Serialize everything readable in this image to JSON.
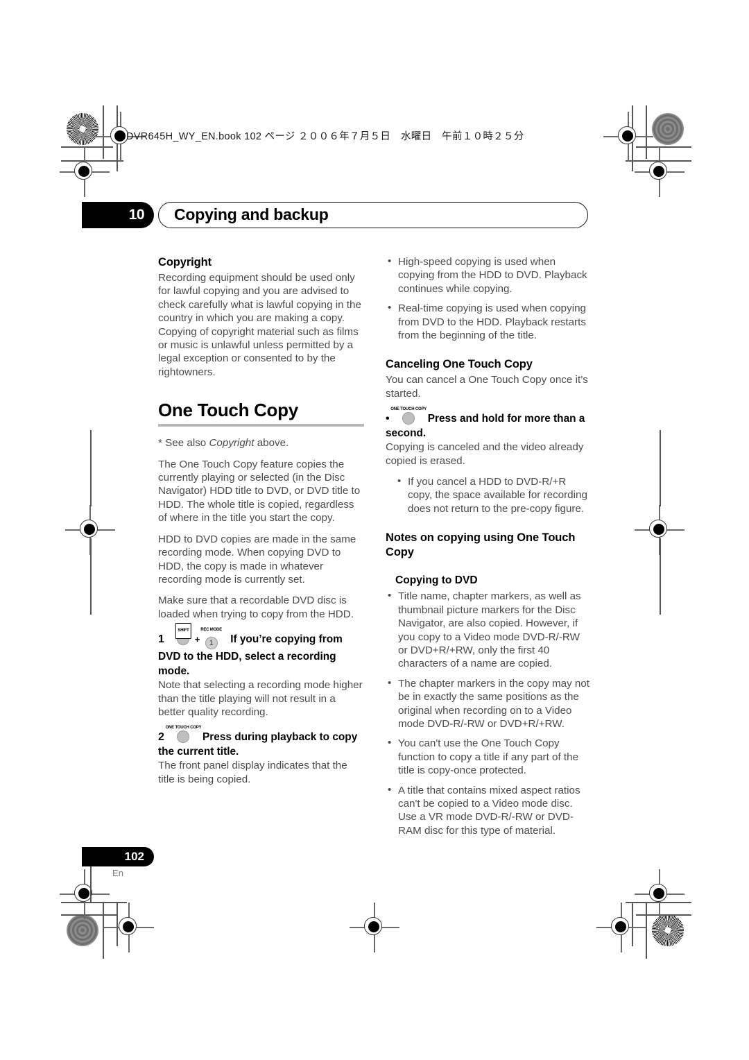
{
  "book_header": "DVR645H_WY_EN.book 102 ページ ２００６年７月５日　水曜日　午前１０時２５分",
  "chapter": {
    "number": "10",
    "title": "Copying and backup"
  },
  "footer": {
    "page_number": "102",
    "language": "En"
  },
  "left_column": {
    "copyright_heading": "Copyright",
    "copyright_body": "Recording equipment should be used only for lawful copying and you are advised to check carefully what is lawful copying in the country in which you are making a copy. Copying of copyright material such as films or music is unlawful unless permitted by a legal exception or consented to by the rightowners.",
    "one_touch_copy_heading": "One Touch Copy",
    "see_also_prefix": "* See also ",
    "see_also_italic": "Copyright",
    "see_also_suffix": " above.",
    "para_feature": "The One Touch Copy feature copies the currently playing or selected (in the Disc Navigator) HDD title to DVD, or DVD title to HDD. The whole title is copied, regardless of where in the title you start the copy.",
    "para_modes": "HDD to DVD copies are made in the same recording mode. When copying DVD to HDD, the copy is made in whatever recording mode is currently set.",
    "para_disc": "Make sure that a recordable DVD disc is loaded when trying to copy from the HDD.",
    "step1": {
      "number": "1",
      "button_shift_label": "SHIFT",
      "plus": "+",
      "button_recmode_label": "REC MODE",
      "button_recmode_value": "1",
      "instruction": "If you’re copying from DVD to the HDD, select a recording mode.",
      "body": "Note that selecting a recording mode higher than the title playing will not result in a better quality recording."
    },
    "step2": {
      "number": "2",
      "button_label": "ONE TOUCH COPY",
      "instruction": "Press during playback to copy the current title.",
      "body": "The front panel display indicates that the title is being copied."
    }
  },
  "right_column": {
    "top_bullets": [
      "High-speed copying is used when copying from the HDD to DVD. Playback continues while copying.",
      "Real-time copying is used when copying from DVD to the HDD. Playback restarts from the beginning of the title."
    ],
    "canceling_heading": "Canceling One Touch Copy",
    "canceling_body": "You can cancel a One Touch Copy once it’s started.",
    "cancel_step": {
      "button_label": "ONE TOUCH COPY",
      "instruction": "Press and hold for more than a second.",
      "body": "Copying is canceled and the video already copied is erased."
    },
    "cancel_bullets": [
      "If you cancel a HDD to DVD-R/+R copy, the space available for recording does not return to the pre-copy figure."
    ],
    "notes_heading": "Notes on copying using One Touch Copy",
    "copying_to_dvd_heading": "Copying to DVD",
    "copying_to_dvd_bullets": [
      "Title name, chapter markers, as well as thumbnail picture markers for the Disc Navigator, are also copied. However, if you copy to a Video mode DVD-R/-RW or DVD+R/+RW, only the first 40 characters of a name are copied.",
      "The chapter markers in the copy may not be in exactly the same positions as the original when recording on to a Video mode DVD-R/-RW or DVD+R/+RW.",
      "You can't use the One Touch Copy function to copy a title if any part of the title is copy-once protected.",
      "A title that contains mixed aspect ratios can't be copied to a Video mode disc. Use a VR mode DVD-R/-RW or DVD-RAM disc for this type of material."
    ]
  }
}
